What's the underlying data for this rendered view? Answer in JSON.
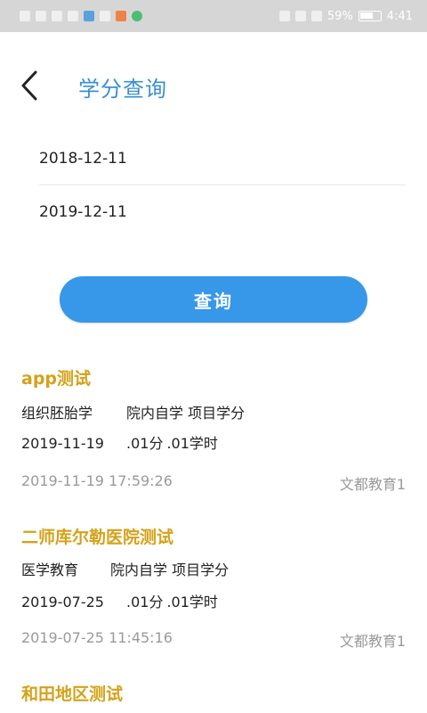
{
  "status_bar": {
    "battery": "59%",
    "time": "4:41"
  },
  "header": {
    "title": "学分查询"
  },
  "query": {
    "start_date": "2018-12-11",
    "end_date": "2019-12-11",
    "button_label": "查询"
  },
  "records": [
    {
      "title": "app测试",
      "course": "组织胚胎学",
      "category": "院内自学 项目学分",
      "date": "2019-11-19",
      "credits": ".01分",
      "hours": ".01学时",
      "timestamp": "2019-11-19 17:59:26",
      "org": "文都教育1"
    },
    {
      "title": "二师库尔勒医院测试",
      "course": "医学教育",
      "category": "院内自学 项目学分",
      "date": "2019-07-25",
      "credits": ".01分",
      "hours": ".01学时",
      "timestamp": "2019-07-25 11:45:16",
      "org": "文都教育1"
    },
    {
      "title": "和田地区测试"
    }
  ]
}
